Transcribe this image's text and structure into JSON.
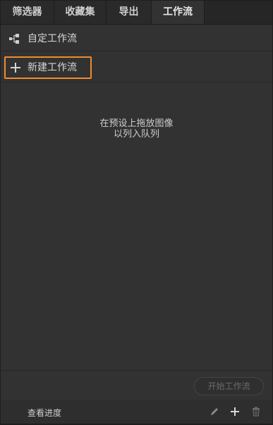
{
  "tabs": [
    {
      "label": "筛选器"
    },
    {
      "label": "收藏集"
    },
    {
      "label": "导出"
    },
    {
      "label": "工作流"
    }
  ],
  "custom_workflow": {
    "label": "自定工作流",
    "icon": "workflow-icon"
  },
  "new_workflow": {
    "label": "新建工作流",
    "icon": "plus-icon",
    "highlight_color": "#f08c2c"
  },
  "drop_hint": {
    "line1": "在预设上拖放图像",
    "line2": "以列入队列"
  },
  "start_button": {
    "label": "开始工作流"
  },
  "footer": {
    "progress_label": "查看进度",
    "icons": [
      "pencil-icon",
      "plus-icon",
      "trash-icon"
    ]
  }
}
